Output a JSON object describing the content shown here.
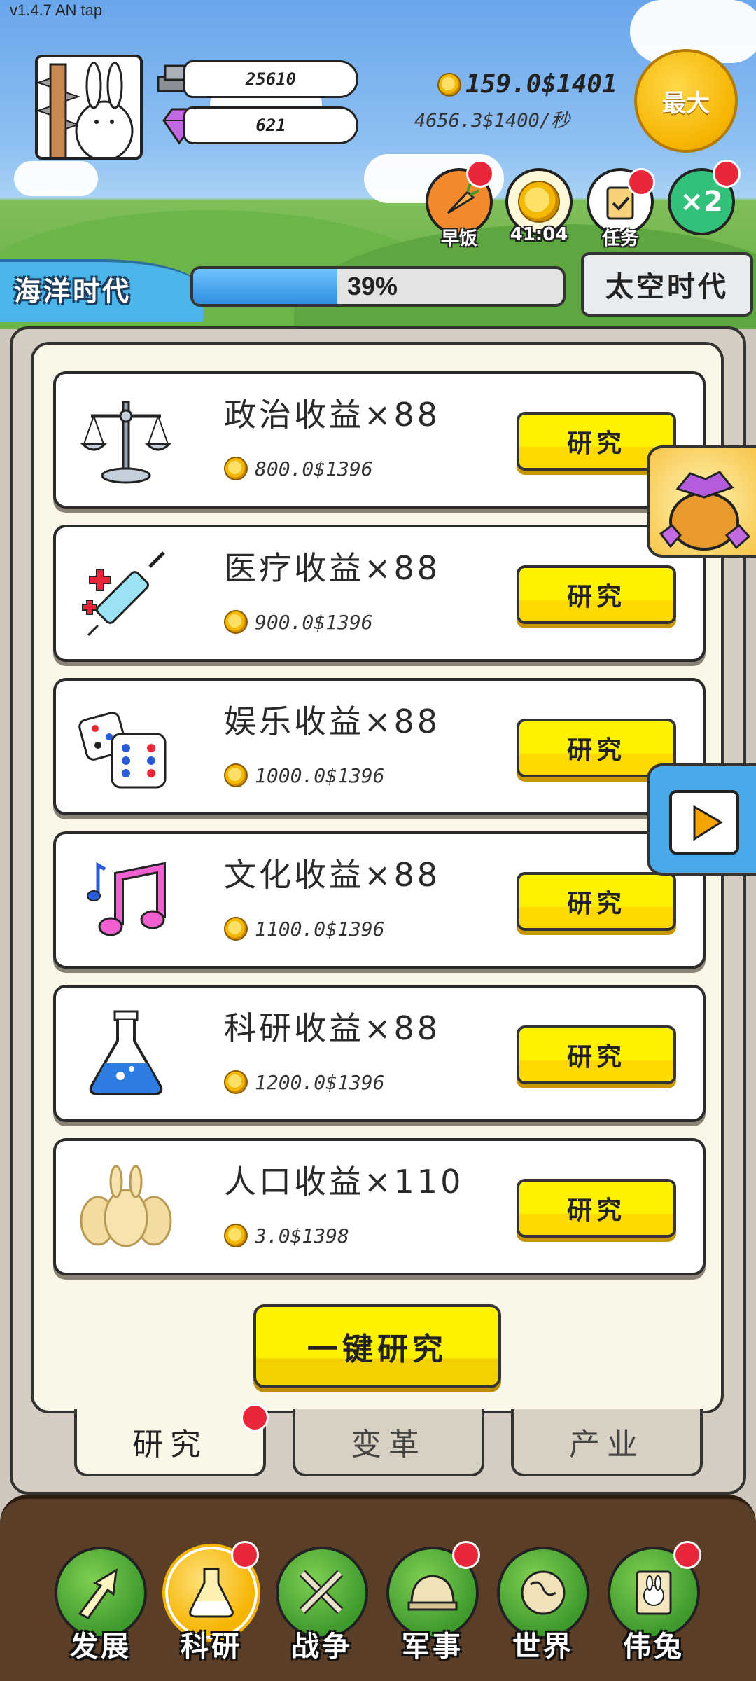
{
  "version": "v1.4.7 AN tap",
  "resources": {
    "silver": "25610",
    "gems": "621"
  },
  "gold": {
    "amount": "159.0$1401",
    "rate": "4656.3$1400/秒"
  },
  "max_button": "最大",
  "top_buttons": [
    {
      "label": "早饭",
      "icon": "carrot-icon"
    },
    {
      "label": "41:04",
      "icon": "coin-icon"
    },
    {
      "label": "任务",
      "icon": "clipboard-icon"
    },
    {
      "label": "×2",
      "icon": "double-icon"
    }
  ],
  "era": {
    "current": "海洋时代",
    "next": "太空时代",
    "progress_text": "39%",
    "progress": 0.39
  },
  "research_items": [
    {
      "title": "政治收益×88",
      "cost": "800.0$1396",
      "button": "研究",
      "icon": "scales-icon"
    },
    {
      "title": "医疗收益×88",
      "cost": "900.0$1396",
      "button": "研究",
      "icon": "syringe-icon"
    },
    {
      "title": "娱乐收益×88",
      "cost": "1000.0$1396",
      "button": "研究",
      "icon": "dice-icon"
    },
    {
      "title": "文化收益×88",
      "cost": "1100.0$1396",
      "button": "研究",
      "icon": "music-note-icon"
    },
    {
      "title": "科研收益×88",
      "cost": "1200.0$1396",
      "button": "研究",
      "icon": "flask-icon"
    },
    {
      "title": "人口收益×110",
      "cost": "3.0$1398",
      "button": "研究",
      "icon": "rabbits-icon"
    }
  ],
  "one_key_button": "一键研究",
  "sub_tabs": [
    "研究",
    "变革",
    "产业"
  ],
  "nav": [
    "发展",
    "科研",
    "战争",
    "军事",
    "世界",
    "伟兔"
  ],
  "colors": {
    "accent_yellow": "#fff200",
    "badge_red": "#e8283a",
    "nav_green": "#3f9a2d"
  }
}
